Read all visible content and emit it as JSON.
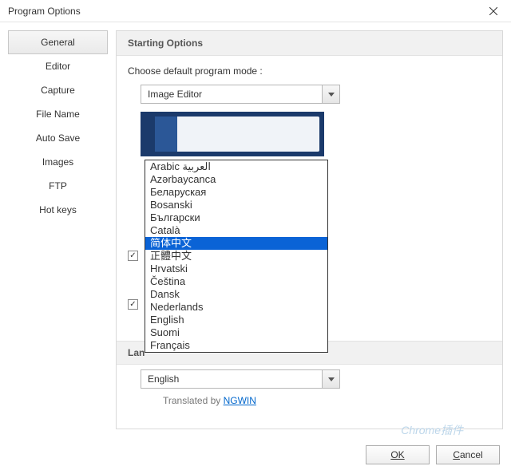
{
  "window": {
    "title": "Program Options"
  },
  "sidebar": {
    "items": [
      {
        "label": "General",
        "selected": true
      },
      {
        "label": "Editor",
        "selected": false
      },
      {
        "label": "Capture",
        "selected": false
      },
      {
        "label": "File Name",
        "selected": false
      },
      {
        "label": "Auto Save",
        "selected": false
      },
      {
        "label": "Images",
        "selected": false
      },
      {
        "label": "FTP",
        "selected": false
      },
      {
        "label": "Hot keys",
        "selected": false
      }
    ]
  },
  "sections": {
    "starting": {
      "header": "Starting Options",
      "mode_label": "Choose default program mode :",
      "mode_value": "Image Editor"
    },
    "language": {
      "header_partial": "Lan",
      "combo_value": "English",
      "translated_prefix": "Translated by ",
      "translated_link": "NGWIN"
    }
  },
  "language_list": {
    "options": [
      {
        "label": "Arabic العربية",
        "selected": false
      },
      {
        "label": "Azərbaycanca",
        "selected": false
      },
      {
        "label": "Беларуская",
        "selected": false
      },
      {
        "label": "Bosanski",
        "selected": false
      },
      {
        "label": "Български",
        "selected": false
      },
      {
        "label": "Català",
        "selected": false
      },
      {
        "label": "简体中文",
        "selected": true
      },
      {
        "label": "正體中文",
        "selected": false
      },
      {
        "label": "Hrvatski",
        "selected": false
      },
      {
        "label": "Čeština",
        "selected": false
      },
      {
        "label": "Dansk",
        "selected": false
      },
      {
        "label": "Nederlands",
        "selected": false
      },
      {
        "label": "English",
        "selected": false
      },
      {
        "label": "Suomi",
        "selected": false
      },
      {
        "label": "Français",
        "selected": false
      }
    ]
  },
  "checkboxes": {
    "cb1": true,
    "cb2": true
  },
  "footer": {
    "ok": "OK",
    "cancel_prefix": "",
    "cancel_ul": "C",
    "cancel_rest": "ancel"
  },
  "watermark": "Chrome插件"
}
